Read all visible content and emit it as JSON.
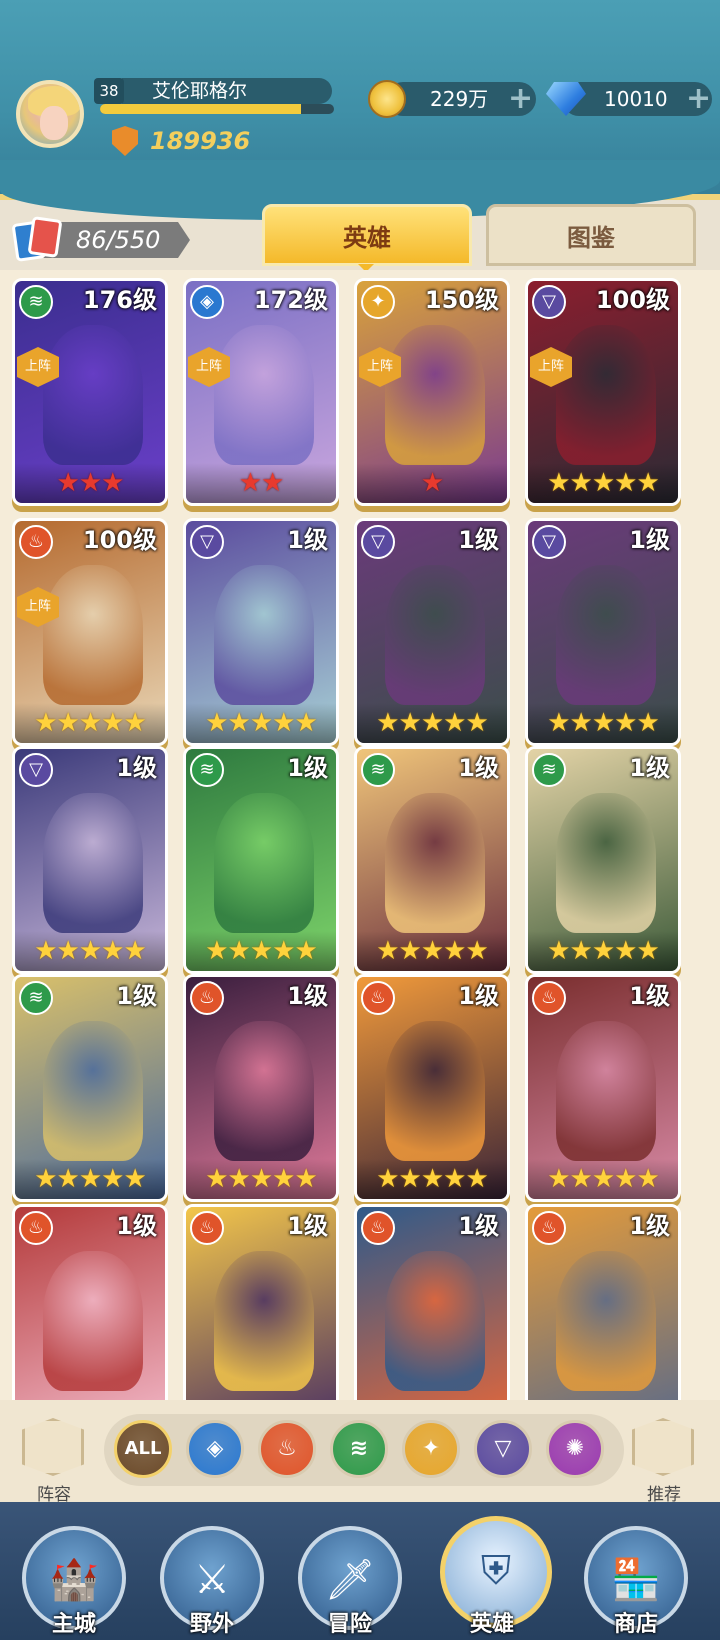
{
  "player": {
    "level": "38",
    "name": "艾伦耶格尔",
    "exp_fraction": 0.86,
    "power": "189936"
  },
  "resources": {
    "gold": "229万",
    "gems": "10010"
  },
  "collection": {
    "count": "86/550"
  },
  "tabs": {
    "heroes": "英雄",
    "codex": "图鉴"
  },
  "heroes": [
    {
      "level": "176级",
      "faction": "wind",
      "deployed": "上阵",
      "stars": "★★★",
      "star_color": "red",
      "bg": [
        "#3b2e8f",
        "#6a3fc9"
      ]
    },
    {
      "level": "172级",
      "faction": "water",
      "deployed": "上阵",
      "stars": "★★",
      "star_color": "red",
      "bg": [
        "#7a6fc4",
        "#c9a6de"
      ]
    },
    {
      "level": "150级",
      "faction": "light",
      "deployed": "上阵",
      "stars": "★",
      "star_color": "red",
      "bg": [
        "#d9a23b",
        "#7a3b8f"
      ]
    },
    {
      "level": "100级",
      "faction": "dark",
      "deployed": "上阵",
      "stars": "★★★★★",
      "star_color": "gold",
      "bg": [
        "#8b1e2e",
        "#2b2b35"
      ]
    },
    {
      "level": "100级",
      "faction": "fire",
      "deployed": "上阵",
      "stars": "★★★★★",
      "star_color": "gold",
      "bg": [
        "#b56a2f",
        "#e9d7b7"
      ]
    },
    {
      "level": "1级",
      "faction": "dark",
      "deployed": "",
      "stars": "★★★★★",
      "star_color": "gold",
      "bg": [
        "#5b4c9e",
        "#a7d0d5"
      ]
    },
    {
      "level": "1级",
      "faction": "dark",
      "deployed": "",
      "stars": "★★★★★",
      "star_color": "gold",
      "bg": [
        "#6a3a7a",
        "#3b4e4a"
      ]
    },
    {
      "level": "1级",
      "faction": "dark",
      "deployed": "",
      "stars": "★★★★★",
      "star_color": "gold",
      "bg": [
        "#6a3a7a",
        "#3b4e4a"
      ]
    },
    {
      "level": "1级",
      "faction": "dark",
      "deployed": "",
      "stars": "★★★★★",
      "star_color": "gold",
      "bg": [
        "#3b3a7a",
        "#c7b6d9"
      ]
    },
    {
      "level": "1级",
      "faction": "wind",
      "deployed": "",
      "stars": "★★★★★",
      "star_color": "gold",
      "bg": [
        "#2e7a3f",
        "#7dd36a"
      ]
    },
    {
      "level": "1级",
      "faction": "wind",
      "deployed": "",
      "stars": "★★★★★",
      "star_color": "gold",
      "bg": [
        "#f0c57a",
        "#6a2f3e"
      ]
    },
    {
      "level": "1级",
      "faction": "wind",
      "deployed": "",
      "stars": "★★★★★",
      "star_color": "gold",
      "bg": [
        "#e3d3a6",
        "#3d5b3a"
      ]
    },
    {
      "level": "1级",
      "faction": "wind",
      "deployed": "",
      "stars": "★★★★★",
      "star_color": "gold",
      "bg": [
        "#d9c06a",
        "#4a6a9e"
      ]
    },
    {
      "level": "1级",
      "faction": "fire",
      "deployed": "",
      "stars": "★★★★★",
      "star_color": "gold",
      "bg": [
        "#3a1e3e",
        "#e07a9a"
      ]
    },
    {
      "level": "1级",
      "faction": "fire",
      "deployed": "",
      "stars": "★★★★★",
      "star_color": "gold",
      "bg": [
        "#f19a3a",
        "#3a2438"
      ]
    },
    {
      "level": "1级",
      "faction": "fire",
      "deployed": "",
      "stars": "★★★★★",
      "star_color": "gold",
      "bg": [
        "#7a2e2e",
        "#d88aa6"
      ]
    },
    {
      "level": "1级",
      "faction": "fire",
      "deployed": "",
      "stars": "",
      "star_color": "gold",
      "bg": [
        "#b43a3a",
        "#f2b8c8"
      ]
    },
    {
      "level": "1级",
      "faction": "fire",
      "deployed": "",
      "stars": "",
      "star_color": "gold",
      "bg": [
        "#f3c64a",
        "#4a3063"
      ]
    },
    {
      "level": "1级",
      "faction": "fire",
      "deployed": "",
      "stars": "",
      "star_color": "gold",
      "bg": [
        "#2f5a8a",
        "#e6673a"
      ]
    },
    {
      "level": "1级",
      "faction": "fire",
      "deployed": "",
      "stars": "",
      "star_color": "gold",
      "bg": [
        "#e49b3a",
        "#5a6a8a"
      ]
    }
  ],
  "faction_icons": {
    "wind": "≋",
    "water": "◈",
    "light": "✦",
    "dark": "▽",
    "fire": "♨"
  },
  "faction_colors": {
    "wind": "#2e9a4a",
    "water": "#2a78d0",
    "light": "#e6a62b",
    "dark": "#5a4aa0",
    "fire": "#e0542a"
  },
  "filters": [
    {
      "label": "ALL",
      "color": "#6b4a2a"
    },
    {
      "label": "◈",
      "color": "#2a78d0"
    },
    {
      "label": "♨",
      "color": "#e0542a"
    },
    {
      "label": "≋",
      "color": "#2e9a4a"
    },
    {
      "label": "✦",
      "color": "#e6a62b"
    },
    {
      "label": "▽",
      "color": "#5a4aa0"
    },
    {
      "label": "✺",
      "color": "#9a3ab0"
    }
  ],
  "side": {
    "lineup": "阵容",
    "recommend": "推荐"
  },
  "nav": [
    {
      "label": "主城",
      "icon": "🏰"
    },
    {
      "label": "野外",
      "icon": "⚔"
    },
    {
      "label": "冒险",
      "icon": "🗡"
    },
    {
      "label": "英雄",
      "icon": "⛨"
    },
    {
      "label": "商店",
      "icon": "🏪"
    }
  ]
}
